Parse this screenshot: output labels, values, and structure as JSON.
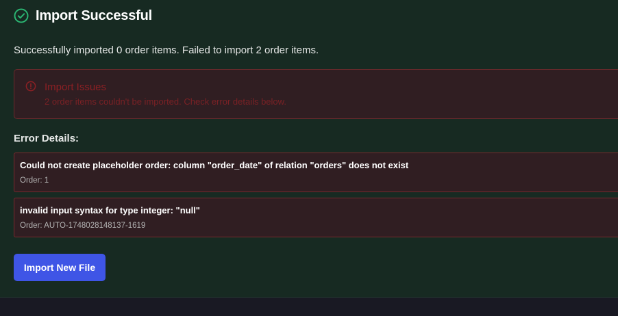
{
  "header": {
    "title": "Import Successful",
    "icon": "check-circle-icon",
    "icon_color": "#2bb673"
  },
  "summary": "Successfully imported 0 order items. Failed to import 2 order items.",
  "issues": {
    "icon": "alert-circle-icon",
    "title": "Import Issues",
    "text": "2 order items couldn't be imported. Check error details below.",
    "color": "#8c2024"
  },
  "errors": {
    "heading": "Error Details:",
    "items": [
      {
        "message": "Could not create placeholder order: column \"order_date\" of relation \"orders\" does not exist",
        "order": "Order: 1"
      },
      {
        "message": "invalid input syntax for type integer: \"null\"",
        "order": "Order: AUTO-1748028148137-1619"
      }
    ]
  },
  "actions": {
    "import_new_label": "Import New File",
    "button_color": "#3f55e6"
  }
}
